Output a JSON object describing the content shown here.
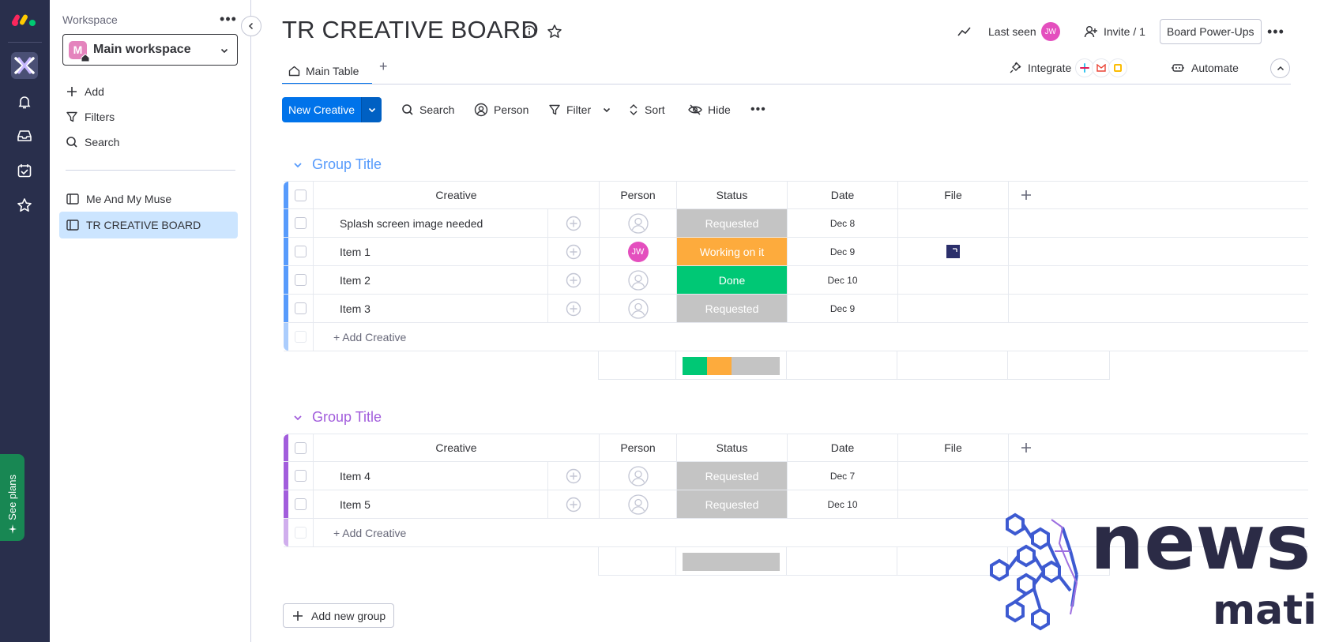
{
  "sidebar_rail": {
    "see_plans": "See plans"
  },
  "workspace": {
    "label": "Workspace",
    "name": "Main workspace",
    "badge_letter": "M",
    "menu": {
      "add": "Add",
      "filters": "Filters",
      "search": "Search"
    },
    "boards": [
      "Me And My Muse",
      "TR CREATIVE BOARD"
    ]
  },
  "header": {
    "title": "TR CREATIVE BOARD",
    "last_seen": "Last seen",
    "last_seen_initials": "JW",
    "invite": "Invite / 1",
    "power_ups": "Board Power-Ups",
    "tab_main": "Main Table",
    "tab_add": "+",
    "integrate": "Integrate",
    "automate": "Automate"
  },
  "toolbar": {
    "new_item": "New Creative",
    "search": "Search",
    "person": "Person",
    "filter": "Filter",
    "sort": "Sort",
    "hide": "Hide"
  },
  "columns": {
    "name": "Creative",
    "person": "Person",
    "status": "Status",
    "date": "Date",
    "file": "File",
    "add": "+"
  },
  "colors": {
    "requested": "#c4c4c4",
    "working": "#fdab3d",
    "done": "#00c875",
    "group1": "#579bfc",
    "group2": "#a25ddc"
  },
  "groups": [
    {
      "title": "Group Title",
      "color": "#579bfc",
      "add_row": "+ Add Creative",
      "rows": [
        {
          "name": "Splash screen image needed",
          "person": "",
          "status": "Requested",
          "status_color": "#c4c4c4",
          "date": "Dec 8",
          "file": false
        },
        {
          "name": "Item 1",
          "person": "JW",
          "status": "Working on it",
          "status_color": "#fdab3d",
          "date": "Dec 9",
          "file": true
        },
        {
          "name": "Item 2",
          "person": "",
          "status": "Done",
          "status_color": "#00c875",
          "date": "Dec 10",
          "file": false
        },
        {
          "name": "Item 3",
          "person": "",
          "status": "Requested",
          "status_color": "#c4c4c4",
          "date": "Dec 9",
          "file": false
        }
      ],
      "status_summary": [
        {
          "color": "#00c875",
          "fraction": 0.25
        },
        {
          "color": "#fdab3d",
          "fraction": 0.25
        },
        {
          "color": "#c4c4c4",
          "fraction": 0.5
        }
      ]
    },
    {
      "title": "Group Title",
      "color": "#a25ddc",
      "add_row": "+ Add Creative",
      "rows": [
        {
          "name": "Item 4",
          "person": "",
          "status": "Requested",
          "status_color": "#c4c4c4",
          "date": "Dec 7",
          "file": false
        },
        {
          "name": "Item 5",
          "person": "",
          "status": "Requested",
          "status_color": "#c4c4c4",
          "date": "Dec 10",
          "file": false
        }
      ],
      "status_summary": [
        {
          "color": "#c4c4c4",
          "fraction": 1.0
        }
      ]
    }
  ],
  "add_group": "Add new group",
  "watermark": {
    "line1": "news",
    "line2": "matic"
  }
}
